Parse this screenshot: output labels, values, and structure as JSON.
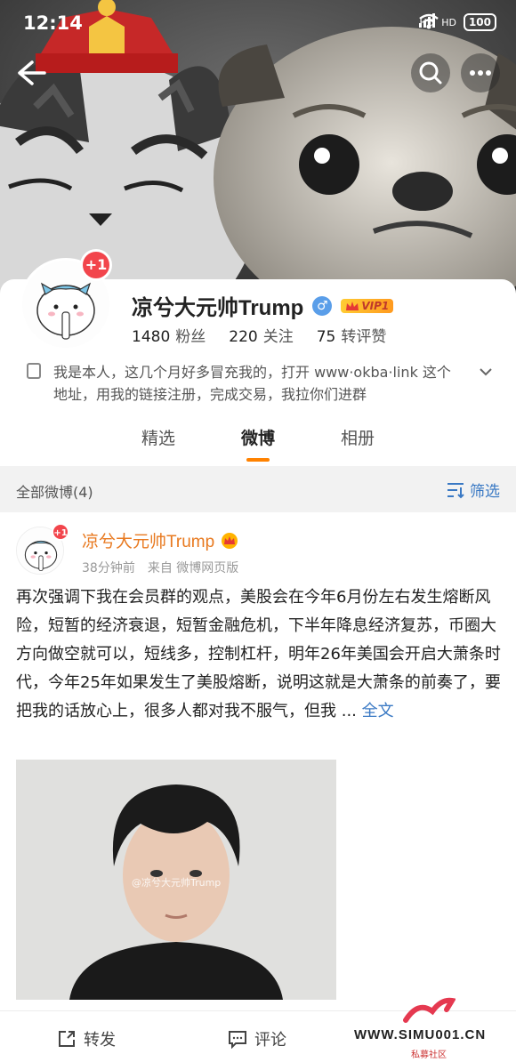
{
  "status_bar": {
    "time": "12:14",
    "net1": "HD",
    "net2": "HD",
    "battery": "100"
  },
  "profile": {
    "avatar_badge": "+1",
    "nickname": "凉兮大元帅Trump",
    "vip_label": "VIP1",
    "stats": [
      {
        "value": "1480",
        "label": "粉丝"
      },
      {
        "value": "220",
        "label": "关注"
      },
      {
        "value": "75",
        "label": "转评赞"
      }
    ],
    "bio": "我是本人，这几个月好多冒充我的，打开 www·okba·link 这个地址，用我的链接注册，完成交易，我拉你们进群"
  },
  "tabs": [
    {
      "label": "精选",
      "active": false
    },
    {
      "label": "微博",
      "active": true
    },
    {
      "label": "相册",
      "active": false
    }
  ],
  "filter": {
    "count_label": "全部微博(4)",
    "filter_label": "筛选"
  },
  "post": {
    "avatar_badge": "+1",
    "author": "凉兮大元帅Trump",
    "time": "38分钟前",
    "source": "来自 微博网页版",
    "text": "再次强调下我在会员群的观点，美股会在今年6月份左右发生熔断风险，短暂的经济衰退，短暂金融危机，下半年降息经济复苏，币圈大方向做空就可以，短线多，控制杠杆，明年26年美国会开启大萧条时代，今年25年如果发生了美股熔断，说明这就是大萧条的前奏了，要把我的话放心上，很多人都对我不服气，但我 ... ",
    "more_label": "全文",
    "image_watermark": "@凉兮大元帅Trump"
  },
  "actions": {
    "repost_label": "转发",
    "comment_label": "评论"
  },
  "watermark_site": {
    "url": "WWW.SIMU001.CN",
    "sub": "私募社区"
  },
  "colors": {
    "accent": "#ff8200",
    "link": "#3a79c4",
    "author": "#e8791f",
    "badge_red": "#f2454c"
  }
}
